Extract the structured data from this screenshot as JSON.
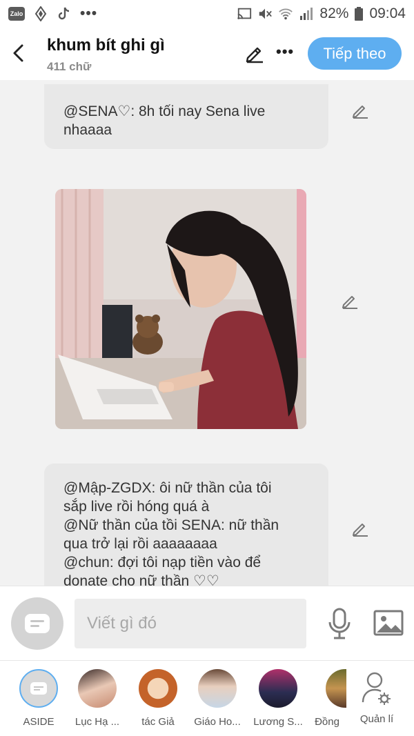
{
  "status_bar": {
    "app_icon_text": "Zalo",
    "battery": "82%",
    "time": "09:04",
    "more": "•••"
  },
  "header": {
    "title": "khum bít ghi gì",
    "subtitle": "411 chữ",
    "more": "•••",
    "next_label": "Tiếp theo"
  },
  "messages": [
    {
      "lines": [
        "@SENA♡: 8h tối nay Sena live",
        "nhaaaa"
      ]
    },
    {
      "lines": [
        "@Mập-ZGDX: ôi nữ thần của tôi",
        "sắp live rồi hóng quá à",
        "@Nữ thần của tồi SENA: nữ thần",
        "qua trở lại rồi aaaaaaaa",
        "@chun: đợi tôi nạp tiền vào để",
        "donate cho nữ thần ♡♡"
      ]
    }
  ],
  "composer": {
    "placeholder": "Viết gì đó"
  },
  "tabs": [
    {
      "label": "ASIDE"
    },
    {
      "label": "Lục Hạ ..."
    },
    {
      "label": "tác Giả"
    },
    {
      "label": "Giáo Ho..."
    },
    {
      "label": "Lương S..."
    },
    {
      "label": "Đồng"
    },
    {
      "label": "Quản lí"
    }
  ],
  "icons": {
    "back": "chevron-left-icon",
    "edit": "pencil-icon",
    "mic": "microphone-icon",
    "image": "image-icon",
    "manage": "user-settings-icon"
  },
  "colors": {
    "accent": "#5eaef0",
    "bubble": "#e8e8e8",
    "background": "#f2f2f2"
  }
}
